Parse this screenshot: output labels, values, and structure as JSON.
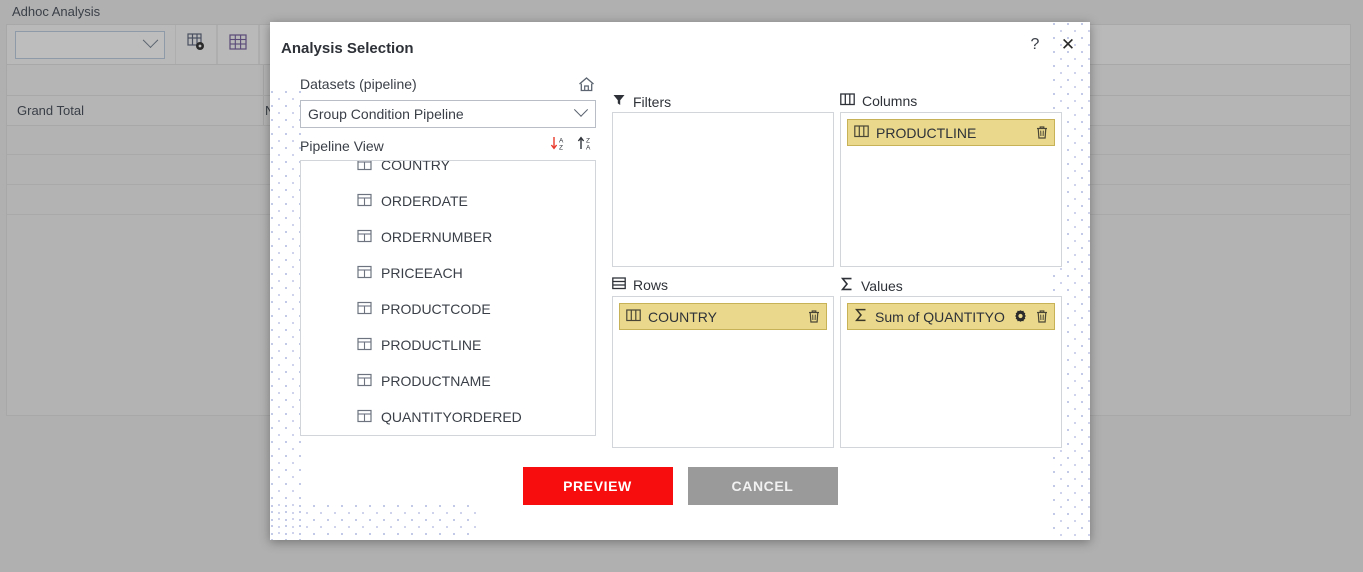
{
  "background": {
    "app_title": "Adhoc Analysis",
    "toolbar": {
      "dataset_select_value": "",
      "icons": [
        "grid-settings-icon",
        "table-icon",
        "table-outline-icon"
      ]
    },
    "grid": {
      "grand_total_label": "Grand Total",
      "grand_total_value": "N"
    }
  },
  "dialog": {
    "title": "Analysis Selection",
    "help_label": "?",
    "close_label": "✕",
    "datasets": {
      "label": "Datasets (pipeline)",
      "home_icon": "home-icon",
      "selected": "Group Condition Pipeline"
    },
    "pipeline_view": {
      "label": "Pipeline View",
      "sort_asc_icon": "sort-az-descending-icon",
      "sort_desc_icon": "sort-za-ascending-icon"
    },
    "fields": [
      {
        "label": "COUNTRY",
        "icon": "column-field-icon"
      },
      {
        "label": "ORDERDATE",
        "icon": "column-field-icon"
      },
      {
        "label": "ORDERNUMBER",
        "icon": "column-field-icon"
      },
      {
        "label": "PRICEEACH",
        "icon": "column-field-icon"
      },
      {
        "label": "PRODUCTCODE",
        "icon": "column-field-icon"
      },
      {
        "label": "PRODUCTLINE",
        "icon": "column-field-icon"
      },
      {
        "label": "PRODUCTNAME",
        "icon": "column-field-icon"
      },
      {
        "label": "QUANTITYORDERED",
        "icon": "column-field-icon"
      }
    ],
    "panels": {
      "filters": {
        "label": "Filters",
        "icon": "filter-icon",
        "chips": []
      },
      "columns": {
        "label": "Columns",
        "icon": "columns-icon",
        "chips": [
          {
            "label": "PRODUCTLINE",
            "icon": "columns-icon",
            "delete_icon": "trash-icon"
          }
        ]
      },
      "rows": {
        "label": "Rows",
        "icon": "rows-icon",
        "chips": [
          {
            "label": "COUNTRY",
            "icon": "columns-icon",
            "delete_icon": "trash-icon"
          }
        ]
      },
      "values": {
        "label": "Values",
        "icon": "sigma-icon",
        "chips": [
          {
            "label": "Sum of QUANTITYOR…",
            "icon": "sigma-icon",
            "settings_icon": "gear-icon",
            "delete_icon": "trash-icon"
          }
        ]
      }
    },
    "buttons": {
      "preview": "PREVIEW",
      "cancel": "CANCEL"
    },
    "colors": {
      "preview_button": "#f70d0d",
      "cancel_button": "#9a9a9a",
      "chip_fill": "#ead98d",
      "chip_border": "#c8b257",
      "sort_accent": "#e8382b"
    }
  }
}
